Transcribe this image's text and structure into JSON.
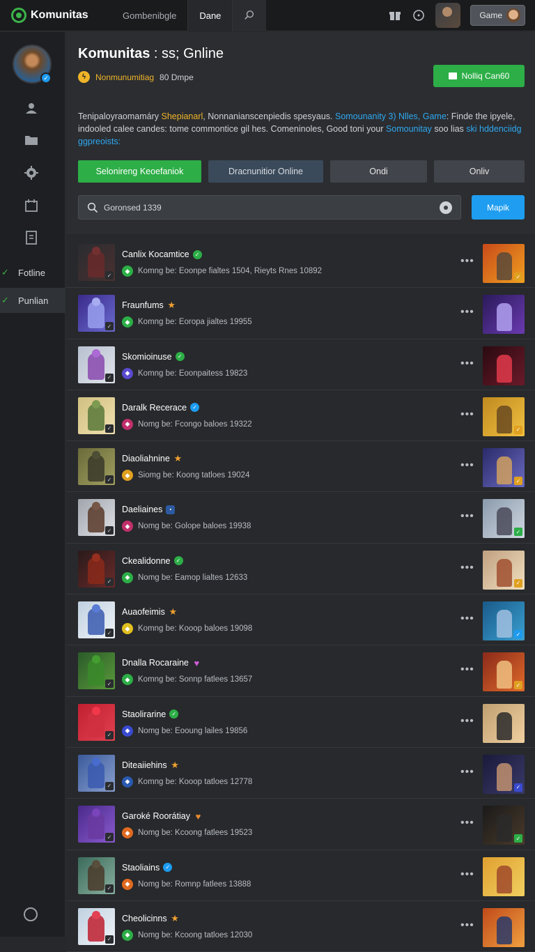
{
  "app": {
    "logo": "Komunitas"
  },
  "topnav": {
    "tabs": [
      {
        "label": "Gombenibgle"
      },
      {
        "label": "Dane"
      }
    ],
    "user_chip": "Game"
  },
  "sidebar": {
    "links": [
      {
        "label": "Fotline"
      },
      {
        "label": "Punlian"
      }
    ]
  },
  "header": {
    "title_bold": "Komunitas",
    "title_rest": " : ss; Gnline",
    "meta_name": "Nonmunumitiag",
    "meta_count": "80 Dmpe",
    "cta_label": "Nolliq Can60",
    "desc": {
      "p1": "Tenipaloyraomamáry ",
      "p2": "Shepianarl",
      "p3": ", Nonnanianscenpiedis spesyaus. ",
      "p4": "Somounanity 3) Nlles, Game",
      "p5": ": Finde the ipyele, indooled calee candes: tome commontice gil hes. Comeninoles, Good toni your ",
      "p6": "Somounitay",
      "p7": " soo lias ",
      "p8": "ski hddenciidg ggpreoists:"
    },
    "filters": [
      {
        "label": "Selonireng Keoefaniok"
      },
      {
        "label": "Dracnunitior Online"
      },
      {
        "label": "Ondi"
      },
      {
        "label": "Onliv"
      }
    ],
    "search_value": "Goronsed 1339",
    "search_button": "Mapik"
  },
  "colors": {
    "accent_green": "#2dae47",
    "accent_blue": "#1f9df0",
    "accent_yellow": "#f0b429"
  },
  "list": [
    {
      "name": "Canlix Kocamtice",
      "badge": "g",
      "sub": "Komng be: Eoonpe fialtes 1504,  Rieyts Rnes 10892",
      "ico": "#2dae47",
      "t1": "#2a2c30",
      "t2": "#4a3030",
      "f": "#6a2a2a",
      "g1": "#c84a1a",
      "g2": "#f0a020",
      "gf": "#5a4a3a",
      "gb": "#e0a020"
    },
    {
      "name": "Fraunfums",
      "badge": "s",
      "sub": "Komng be: Eoropa jialtes 19955",
      "ico": "#2dae47",
      "t1": "#3a2a8a",
      "t2": "#6a6ad0",
      "f": "#9aa0f0",
      "g1": "#2a1a5a",
      "g2": "#6a3ab0",
      "gf": "#b0a0f0",
      "gb": ""
    },
    {
      "name": "Skomioinuse",
      "badge": "g",
      "sub": "Komng be: Eoonpaitess 19823",
      "ico": "#5a4ad0",
      "t1": "#b8c0d0",
      "t2": "#e0e4ea",
      "f": "#8a4ab0",
      "g1": "#2a0a10",
      "g2": "#6a1a2a",
      "gf": "#e03a4a",
      "gb": ""
    },
    {
      "name": "Daralk Recerace",
      "badge": "b",
      "sub": "Nomg be: Fcongo baloes 19322",
      "ico": "#c0306a",
      "t1": "#d0c080",
      "t2": "#f0e0b0",
      "f": "#5a7a3a",
      "g1": "#c08a20",
      "g2": "#f0c040",
      "gf": "#6a4a20",
      "gb": "#e0a020"
    },
    {
      "name": "Diaoliahnine",
      "badge": "s",
      "sub": "Siomg be: Koong tatloes 19024",
      "ico": "#e0a020",
      "t1": "#6a6a3a",
      "t2": "#a0a060",
      "f": "#3a3a2a",
      "g1": "#2a2a6a",
      "g2": "#6a6ac0",
      "gf": "#d0a060",
      "gb": "#e0a020"
    },
    {
      "name": "Daeliaines",
      "badge": "n",
      "sub": "Nomg be: Golope baloes 19938",
      "ico": "#c0306a",
      "t1": "#a0a4ac",
      "t2": "#e0e2e6",
      "f": "#5a3a2a",
      "g1": "#8a9aac",
      "g2": "#d0d8e0",
      "gf": "#4a4a5a",
      "gb": "#2dae47"
    },
    {
      "name": "Ckealidonne",
      "badge": "g",
      "sub": "Nomg be: Eamop lialtes 12633",
      "ico": "#2dae47",
      "t1": "#2a1a1a",
      "t2": "#6a2a2a",
      "f": "#8a2a1a",
      "g1": "#c0a080",
      "g2": "#f0e0c0",
      "gf": "#a05030",
      "gb": "#e0a020"
    },
    {
      "name": "Auaofeimis",
      "badge": "s",
      "sub": "Komng be: Kooop baloes 19098",
      "ico": "#e0c020",
      "t1": "#c0d0e0",
      "t2": "#f0f4f8",
      "f": "#3a5ab0",
      "g1": "#1a5a8a",
      "g2": "#3aa0d0",
      "gf": "#a0c0e0",
      "gb": "#1d9bf0"
    },
    {
      "name": "Dnalla Rocaraine",
      "badge": "h",
      "sub": "Komng be: Sonnp fatlees 13657",
      "ico": "#2dae47",
      "t1": "#2a5a2a",
      "t2": "#5a9a3a",
      "f": "#3a8a2a",
      "g1": "#8a2a1a",
      "g2": "#e06a2a",
      "gf": "#f0c080",
      "gb": "#e0a020"
    },
    {
      "name": "Staolirarine",
      "badge": "g",
      "sub": "Nomg be: Eooung lailes 19856",
      "ico": "#3a4ad0",
      "t1": "#c02030",
      "t2": "#e04050",
      "f": "#d03040",
      "g1": "#c0a070",
      "g2": "#f0d0a0",
      "gf": "#2a2a2a",
      "gb": ""
    },
    {
      "name": "Diteaiiehins",
      "badge": "s",
      "sub": "Komng be: Kooop tatloes 12778",
      "ico": "#2a5ab0",
      "t1": "#3a5a9a",
      "t2": "#8aa0d0",
      "f": "#3a5ab0",
      "g1": "#1a1a3a",
      "g2": "#3a3a6a",
      "gf": "#c09070",
      "gb": "#3a4ad0"
    },
    {
      "name": "Garoké Roorátiay",
      "badge": "o",
      "sub": "Nomg be: Kcoong fatlees 19523",
      "ico": "#e06a20",
      "t1": "#4a2a8a",
      "t2": "#8a5ad0",
      "f": "#6a3aa0",
      "g1": "#1a1a1a",
      "g2": "#4a3a2a",
      "gf": "#2a2a2a",
      "gb": "#2dae47"
    },
    {
      "name": "Staoliains",
      "badge": "b",
      "sub": "Nomg be: Romnp fatlees 13888",
      "ico": "#e06a20",
      "t1": "#3a6a5a",
      "t2": "#8ab0a0",
      "f": "#4a3a2a",
      "g1": "#e0a030",
      "g2": "#f0d060",
      "gf": "#a04a2a",
      "gb": ""
    },
    {
      "name": "Cheolicinns",
      "badge": "s",
      "sub": "Nomg be: Kcoong tatloes 12030",
      "ico": "#2dae47",
      "t1": "#c0d0e0",
      "t2": "#f0f4f8",
      "f": "#c02030",
      "g1": "#c04a1a",
      "g2": "#f0a040",
      "gf": "#2a3a6a",
      "gb": ""
    }
  ]
}
